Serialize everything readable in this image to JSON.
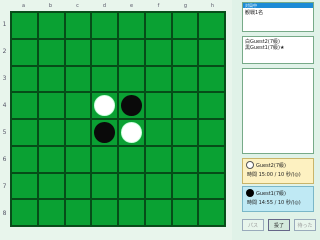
{
  "board": {
    "columns": [
      "a",
      "b",
      "c",
      "d",
      "e",
      "f",
      "g",
      "h"
    ],
    "rows": [
      "1",
      "2",
      "3",
      "4",
      "5",
      "6",
      "7",
      "8"
    ],
    "cells": [
      [
        "",
        "",
        "",
        "",
        "",
        "",
        "",
        ""
      ],
      [
        "",
        "",
        "",
        "",
        "",
        "",
        "",
        ""
      ],
      [
        "",
        "",
        "",
        "",
        "",
        "",
        "",
        ""
      ],
      [
        "",
        "",
        "",
        "w",
        "b",
        "",
        "",
        ""
      ],
      [
        "",
        "",
        "",
        "b",
        "w",
        "",
        "",
        ""
      ],
      [
        "",
        "",
        "",
        "",
        "",
        "",
        "",
        ""
      ],
      [
        "",
        "",
        "",
        "",
        "",
        "",
        "",
        ""
      ],
      [
        "",
        "",
        "",
        "",
        "",
        "",
        "",
        ""
      ]
    ]
  },
  "status": {
    "header": "対局中",
    "text": "観戦1名"
  },
  "players_list": [
    "白Guest2(7級)",
    "黒Guest1(7級)★"
  ],
  "white_player": {
    "name": "Guest2(7級)",
    "time": "時間 15:00 / 10 秒/(◎)"
  },
  "black_player": {
    "name": "Guest1(7級)",
    "time": "時間 14:55 / 10 秒/(◎)"
  },
  "buttons": {
    "pass": "パス",
    "resign": "投了",
    "undo": "待った"
  },
  "colors": {
    "board": "#0aa133",
    "accent": "#1c8bd6"
  }
}
